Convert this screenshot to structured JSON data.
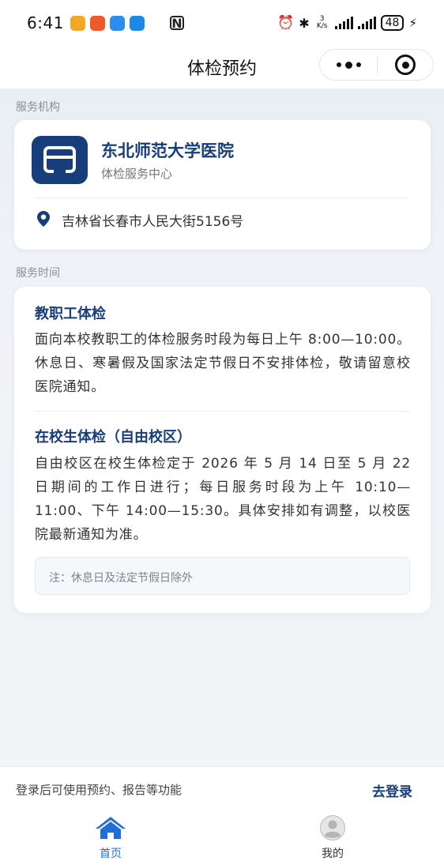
{
  "status_bar": {
    "time": "6:41",
    "network_speed": "3 K/s",
    "battery": "48"
  },
  "nav": {
    "title": "体检预约",
    "more_icon": "more-dots-icon",
    "close_icon": "target-close-icon"
  },
  "institution": {
    "section_label": "服务机构",
    "name": "东北师范大学医院",
    "subtitle": "体检服务中心",
    "address": "吉林省长春市人民大街5156号",
    "logo_icon": "store-icon",
    "location_icon": "location-pin-icon"
  },
  "schedule": {
    "section_label": "服务时间",
    "staff_title": "教职工体检",
    "staff_text": "面向本校教职工的体检服务时段为每日上午 8:00—10:00。休息日、寒暑假及国家法定节假日不安排体检，敬请留意校医院通知。",
    "student_title": "在校生体检（自由校区）",
    "student_text": "自由校区在校生体检定于 2026 年 5 月 14 日至 5 月 22 日期间的工作日进行；每日服务时段为上午 10:10—11:00、下午 14:00—15:30。具体安排如有调整，以校医院最新通知为准。",
    "note": "注：休息日及法定节假日除外"
  },
  "login": {
    "tip": "登录后可使用预约、报告等功能",
    "button": "去登录"
  },
  "tabs": [
    {
      "label": "首页",
      "icon": "home-icon",
      "active": true
    },
    {
      "label": "我的",
      "icon": "user-avatar-icon",
      "active": false
    }
  ],
  "colors": {
    "brand": "#173e7a",
    "background": "#f2f4f7"
  }
}
